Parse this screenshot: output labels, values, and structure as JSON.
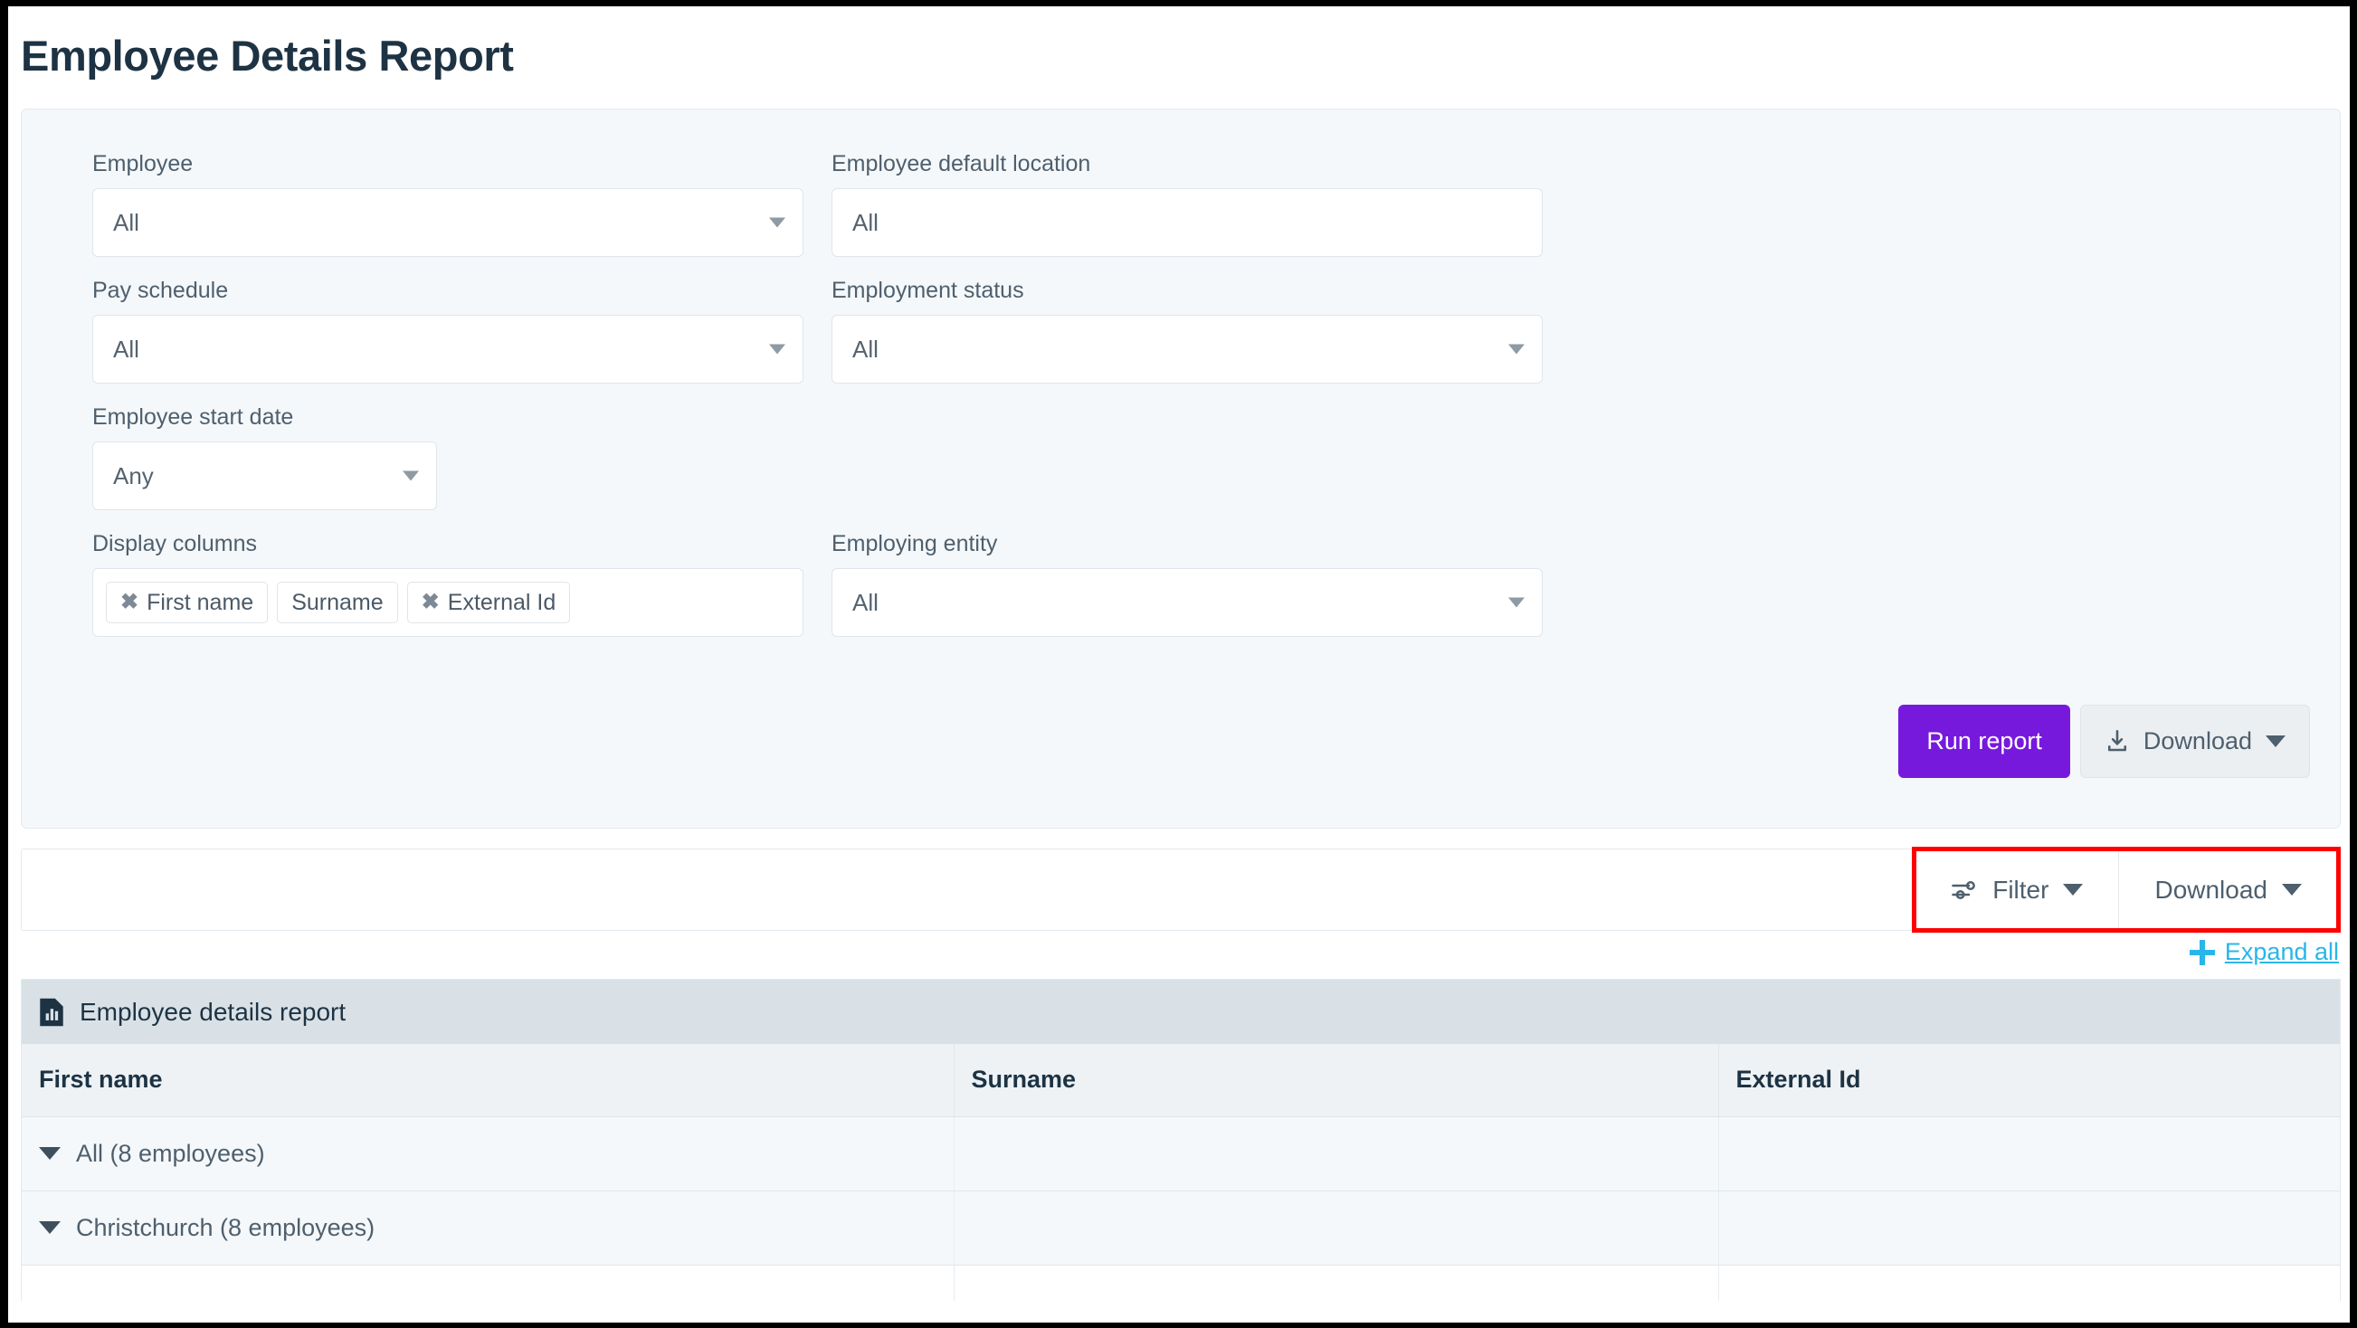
{
  "page": {
    "title": "Employee Details Report"
  },
  "criteria": {
    "fields": [
      {
        "label": "Employee",
        "value": "All",
        "caret": true
      },
      {
        "label": "Employee default location",
        "value": "All",
        "caret": false
      },
      {
        "label": "Pay schedule",
        "value": "All",
        "caret": true
      },
      {
        "label": "Employment status",
        "value": "All",
        "caret": true
      },
      {
        "label": "Employee start date",
        "value": "Any",
        "caret": true
      },
      {
        "label": "Display columns",
        "value": "",
        "caret": false
      },
      {
        "label": "Employing entity",
        "value": "All",
        "caret": true
      }
    ],
    "display_columns": {
      "label": "Display columns",
      "tokens": [
        {
          "text": "First name",
          "removable": true,
          "remove_icon": "close-icon"
        },
        {
          "text": "Surname",
          "removable": false,
          "remove_icon": ""
        },
        {
          "text": "External Id",
          "removable": true,
          "remove_icon": "close-icon"
        }
      ]
    },
    "actions": {
      "run_label": "Run report",
      "download_label": "Download",
      "download_icon": "download-icon",
      "download_caret_icon": "chevron-down-icon"
    }
  },
  "toolbar": {
    "filter_label": "Filter",
    "filter_icon": "tune-icon",
    "filter_caret_icon": "chevron-down-icon",
    "download_label": "Download",
    "download_caret_icon": "chevron-down-icon",
    "highlight_color": "#fe0000"
  },
  "expand": {
    "label": "Expand all",
    "icon": "plus-icon"
  },
  "report": {
    "icon": "report-document-icon",
    "title": "Employee details report",
    "columns": [
      "First name",
      "Surname",
      "External Id"
    ],
    "rows": [
      {
        "label": "All (8 employees)",
        "chevron_icon": "chevron-down-icon",
        "surname": "",
        "external_id": ""
      },
      {
        "label": "Christchurch (8 employees)",
        "chevron_icon": "chevron-down-icon",
        "surname": "",
        "external_id": ""
      }
    ]
  },
  "colors": {
    "accent_purple": "#7719dd",
    "link_blue": "#29b6e8",
    "title_dark": "#1d3344",
    "panel_bg": "#f5f8fa",
    "report_head_bg": "#d9e1e6"
  }
}
